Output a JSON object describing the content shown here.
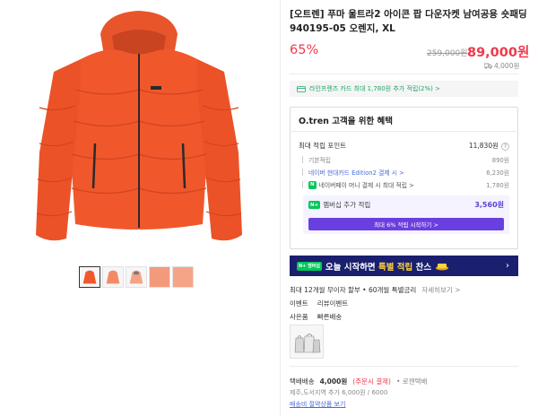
{
  "product": {
    "title": "[오트렌] 푸마 울트라2 아이콘 팝 다운자켓 남여공용 숏패딩 940195-05 오렌지, XL",
    "discount": "65%",
    "original_price": "259,000원",
    "sale_price": "89,000원",
    "delivery_mini": "4,000원"
  },
  "card_benefit": {
    "text": "라인프렌즈 카드 최대 1,780원 추가 적립(2%) >"
  },
  "benefits": {
    "title": "O.tren 고객을 위한 혜택",
    "max_points_label": "최대 적립 포인트",
    "max_points_value": "11,830원",
    "help": "?",
    "basic_label": "기본적립",
    "basic_value": "890원",
    "hyundai_label": "네이버 현대카드 Edition2 결제 시 >",
    "hyundai_value": "6,230원",
    "npay_badge": "N",
    "npay_label": "네이버페이 머니 결제 시 최대 적립 >",
    "npay_value": "1,780원",
    "membership_badge": "N+",
    "membership_label": "멤버십 추가 적립",
    "membership_value": "3,560원",
    "membership_button": "최대 6% 적립 시작하기 >"
  },
  "banner": {
    "badge": "N+ 멤버십",
    "text_prefix": "오늘 시작하면 ",
    "text_highlight": "특별 적립",
    "text_suffix": " 찬스",
    "arrow": "›"
  },
  "info": {
    "installment": "최대 12개월 무이자 할부 • 60개월 특별금리",
    "installment_more": "자세히보기 >",
    "event_label": "이벤트",
    "event_value": "리뷰이벤트",
    "gift_label": "사은품",
    "gift_value": "빠른배송"
  },
  "shipping": {
    "label": "택배배송",
    "price": "4,000원",
    "note": "(주문시 결제)",
    "courier": "• 로젠택배",
    "extra": "제주,도서지역 추가 6,000원 / 6000",
    "link": "배송비 절약상품 보기"
  },
  "colors": {
    "accent_red": "#ef3a4a",
    "naver_green": "#03c75a",
    "membership_purple": "#6a3fe0",
    "banner_navy": "#1a1f6e",
    "jacket_orange": "#f0582c"
  },
  "icons": {
    "card": "card-icon",
    "delivery": "truck-icon",
    "banner_gift": "gift-icon"
  }
}
